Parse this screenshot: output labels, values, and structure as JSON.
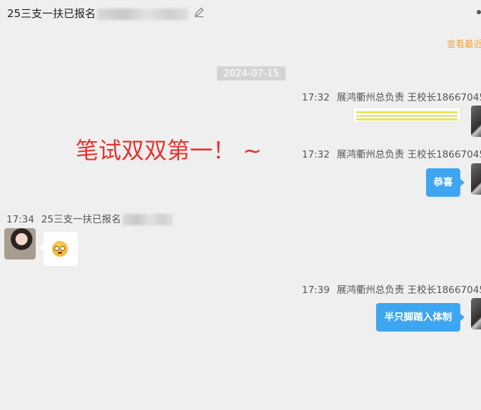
{
  "header": {
    "title": "25三支一扶已报名"
  },
  "recent_link": "查看最近",
  "date_divider": "2024-07-15",
  "overlay_text": "笔试双双第一！ ~",
  "messages": [
    {
      "time": "17:32",
      "sender": "展鸿衢州总负责 王校长18667045",
      "type": "image"
    },
    {
      "time": "17:32",
      "sender": "展鸿衢州总负责 王校长18667045",
      "text": "恭喜"
    },
    {
      "time": "17:34",
      "sender": "25三支一扶已报名",
      "type": "emoji"
    },
    {
      "time": "17:39",
      "sender": "展鸿衢州总负责 王校长18667045",
      "text": "半只脚踏入体制"
    }
  ],
  "colors": {
    "bubble_blue": "#3ea6f0",
    "overlay_red": "#e8332c",
    "link_orange": "#f0a23a",
    "background": "#efefef"
  }
}
